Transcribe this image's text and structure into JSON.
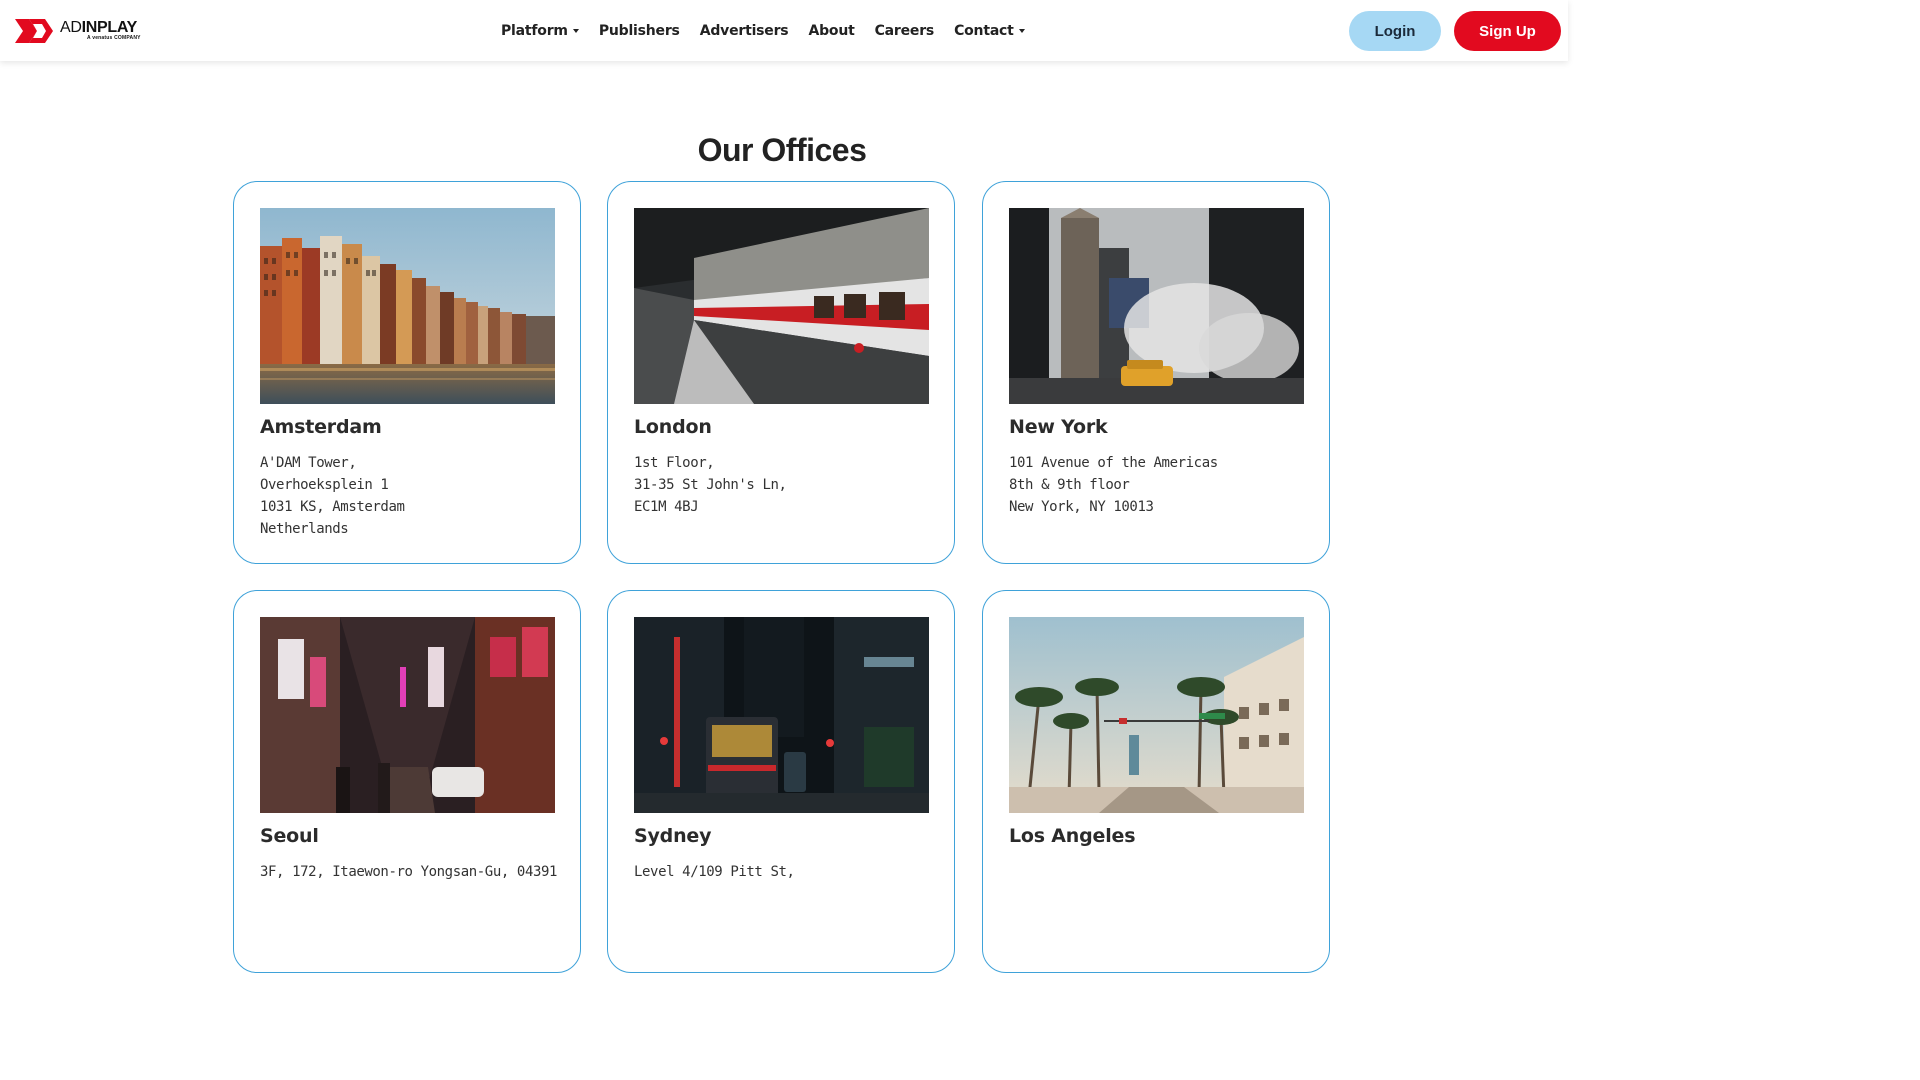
{
  "brand": {
    "logo_text_light": "AD",
    "logo_text_bold": "INPLAY",
    "logo_subtitle": "A venatus COMPANY",
    "accent_red": "#e20a1f",
    "accent_blue": "#a6d8f4",
    "card_border": "#3fa2d9"
  },
  "nav": {
    "items": [
      {
        "label": "Platform",
        "dropdown": true
      },
      {
        "label": "Publishers",
        "dropdown": false
      },
      {
        "label": "Advertisers",
        "dropdown": false
      },
      {
        "label": "About",
        "dropdown": false
      },
      {
        "label": "Careers",
        "dropdown": false
      },
      {
        "label": "Contact",
        "dropdown": true
      }
    ],
    "login_label": "Login",
    "signup_label": "Sign Up"
  },
  "section": {
    "title": "Our Offices"
  },
  "offices": [
    {
      "city": "Amsterdam",
      "photo": "canal-houses-photo",
      "address": [
        "A'DAM Tower,",
        "Overhoeksplein 1",
        "1031 KS, Amsterdam",
        "Netherlands"
      ]
    },
    {
      "city": "London",
      "photo": "underground-train-photo",
      "address": [
        "1st Floor,",
        "31-35 St John's Ln,",
        "EC1M 4BJ"
      ]
    },
    {
      "city": "New York",
      "photo": "street-steam-taxi-photo",
      "address": [
        "101 Avenue of the Americas",
        "8th & 9th floor",
        "New York, NY 10013"
      ]
    },
    {
      "city": "Seoul",
      "photo": "neon-alley-photo",
      "address": [
        "3F, 172, Itaewon-ro Yongsan-Gu, 04391"
      ]
    },
    {
      "city": "Sydney",
      "photo": "night-tram-street-photo",
      "address": [
        "Level 4/109 Pitt St,"
      ]
    },
    {
      "city": "Los Angeles",
      "photo": "palm-boulevard-photo",
      "address": []
    }
  ]
}
